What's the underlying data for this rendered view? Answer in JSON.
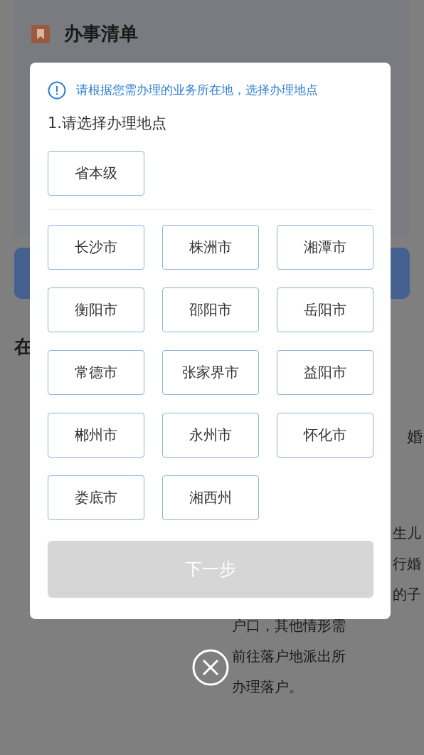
{
  "page": {
    "title": "办事清单",
    "section_title": "在",
    "side_label": "婚",
    "right_lines": [
      "生儿",
      "行婚",
      "的子"
    ],
    "center_lines": [
      "户口，其他情形需",
      "前往落户地派出所",
      "办理落户。"
    ]
  },
  "dialog": {
    "notice": "请根据您需办理的业务所在地，选择办理地点",
    "step_title": "1.请选择办理地点",
    "province_options": [
      {
        "label": "省本级",
        "selected": false
      }
    ],
    "city_options": [
      {
        "label": "长沙市",
        "selected": false
      },
      {
        "label": "株洲市",
        "selected": false
      },
      {
        "label": "湘潭市",
        "selected": false
      },
      {
        "label": "衡阳市",
        "selected": false
      },
      {
        "label": "邵阳市",
        "selected": false
      },
      {
        "label": "岳阳市",
        "selected": false
      },
      {
        "label": "常德市",
        "selected": false
      },
      {
        "label": "张家界市",
        "selected": false
      },
      {
        "label": "益阳市",
        "selected": false
      },
      {
        "label": "郴州市",
        "selected": false
      },
      {
        "label": "永州市",
        "selected": false
      },
      {
        "label": "怀化市",
        "selected": false
      },
      {
        "label": "娄底市",
        "selected": false
      },
      {
        "label": "湘西州",
        "selected": false
      }
    ],
    "next_button": {
      "label": "下一步",
      "disabled": true
    }
  }
}
